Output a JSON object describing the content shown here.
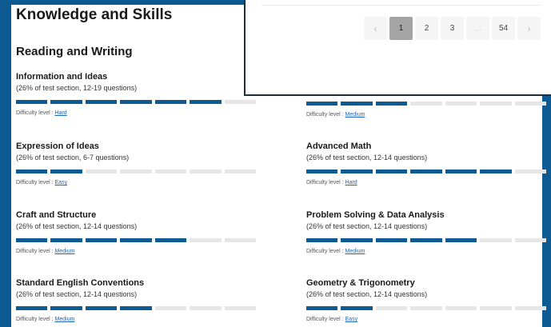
{
  "section_title": "Knowledge and Skills",
  "reading_writing": {
    "title": "Reading and Writing",
    "skills": [
      {
        "name": "Information and Ideas",
        "desc": "(26% of test section, 12-19 questions)",
        "difficulty_label": "Difficulty level :",
        "difficulty": "Hard",
        "filled": 6
      },
      {
        "name": "Expression of Ideas",
        "desc": "(26% of test section, 6-7 questions)",
        "difficulty_label": "Difficulty level :",
        "difficulty": "Easy",
        "filled": 2
      },
      {
        "name": "Craft and Structure",
        "desc": "(26% of test section, 12-14 questions)",
        "difficulty_label": "Difficulty level :",
        "difficulty": "Medium",
        "filled": 5
      },
      {
        "name": "Standard English Conventions",
        "desc": "(26% of test section, 12-14 questions)",
        "difficulty_label": "Difficulty level :",
        "difficulty": "Medium",
        "filled": 4
      }
    ]
  },
  "math": {
    "skills": [
      {
        "name": "",
        "desc": "",
        "difficulty_label": "Difficulty level :",
        "difficulty": "Medium",
        "filled": 3
      },
      {
        "name": "Advanced Math",
        "desc": "(26% of test section, 12-14 questions)",
        "difficulty_label": "Difficulty level :",
        "difficulty": "Hard",
        "filled": 6
      },
      {
        "name": "Problem Solving & Data Analysis",
        "desc": "(26% of test section, 12-14 questions)",
        "difficulty_label": "Difficulty level :",
        "difficulty": "Medium",
        "filled": 5
      },
      {
        "name": "Geometry & Trigonometry",
        "desc": "(26% of test section, 12-14 questions)",
        "difficulty_label": "Difficulty level :",
        "difficulty": "Easy",
        "filled": 2
      }
    ]
  },
  "bar_segments_total": 7,
  "pagination": {
    "prev_icon": "chevron-left-icon",
    "prev": "‹",
    "pages": [
      "1",
      "2",
      "3",
      "...",
      "54"
    ],
    "active_page": "1",
    "next_icon": "chevron-right-icon",
    "next": "›"
  },
  "colors": {
    "accent": "#0e5a92",
    "link": "#1e66b5",
    "empty_segment": "#e6e6e6"
  }
}
